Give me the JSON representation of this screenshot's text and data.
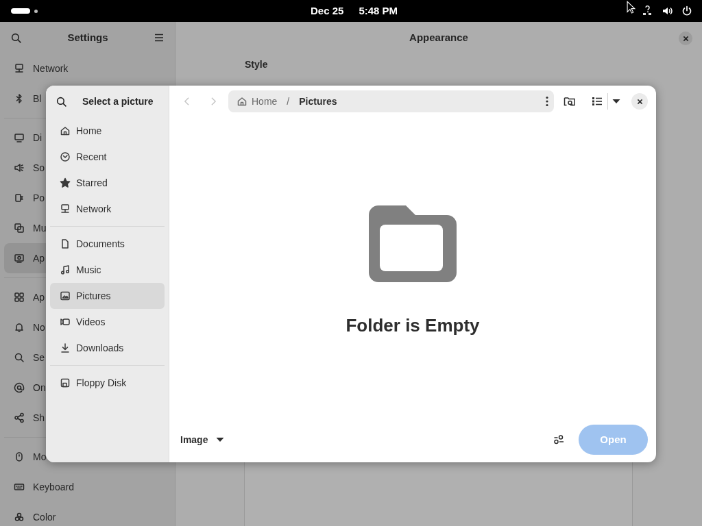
{
  "top_bar": {
    "date": "Dec 25",
    "time": "5:48 PM"
  },
  "settings": {
    "title": "Settings",
    "page_title": "Appearance",
    "section_label": "Style",
    "sidebar_groups": [
      [
        {
          "label": "Network",
          "selected": false
        },
        {
          "label": "Bl",
          "selected": false
        }
      ],
      [
        {
          "label": "Di",
          "selected": false
        },
        {
          "label": "So",
          "selected": false
        },
        {
          "label": "Po",
          "selected": false
        },
        {
          "label": "Mu",
          "selected": false
        },
        {
          "label": "Ap",
          "selected": true
        }
      ],
      [
        {
          "label": "Ap",
          "selected": false
        },
        {
          "label": "No",
          "selected": false
        },
        {
          "label": "Se",
          "selected": false
        },
        {
          "label": "On",
          "selected": false
        },
        {
          "label": "Sh",
          "selected": false
        }
      ],
      [
        {
          "label": "Mo",
          "selected": false
        },
        {
          "label": "Keyboard",
          "selected": false
        },
        {
          "label": "Color",
          "selected": false
        }
      ]
    ]
  },
  "dialog": {
    "title": "Select a picture",
    "places_groups": [
      [
        {
          "label": "Home",
          "selected": false
        },
        {
          "label": "Recent",
          "selected": false
        },
        {
          "label": "Starred",
          "selected": false
        },
        {
          "label": "Network",
          "selected": false
        }
      ],
      [
        {
          "label": "Documents",
          "selected": false
        },
        {
          "label": "Music",
          "selected": false
        },
        {
          "label": "Pictures",
          "selected": true
        },
        {
          "label": "Videos",
          "selected": false
        },
        {
          "label": "Downloads",
          "selected": false
        }
      ],
      [
        {
          "label": "Floppy Disk",
          "selected": false
        }
      ]
    ],
    "back_enabled": false,
    "forward_enabled": false,
    "path": [
      {
        "label": "Home"
      },
      {
        "label": "Pictures"
      }
    ],
    "path_separator": "/",
    "empty_title": "Folder is Empty",
    "filter": "Image",
    "open_button": {
      "label": "Open",
      "disabled": true
    }
  }
}
